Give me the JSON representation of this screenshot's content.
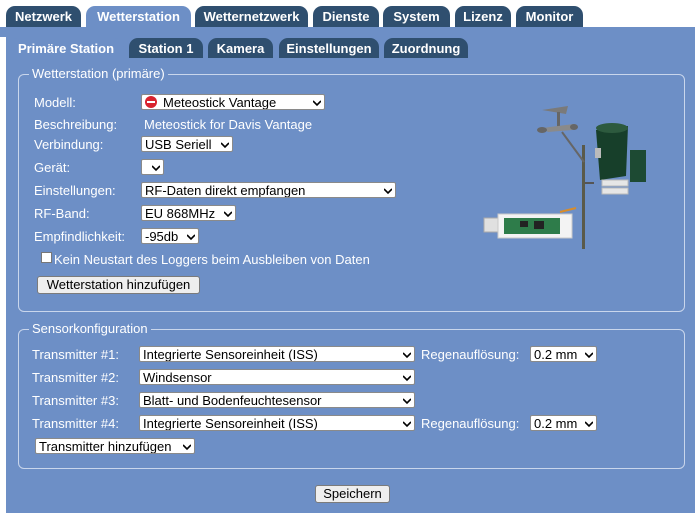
{
  "main_tabs": [
    {
      "label": "Netzwerk",
      "active": false
    },
    {
      "label": "Wetterstation",
      "active": true
    },
    {
      "label": "Wetternetzwerk",
      "active": false
    },
    {
      "label": "Dienste",
      "active": false
    },
    {
      "label": "System",
      "active": false
    },
    {
      "label": "Lizenz",
      "active": false
    },
    {
      "label": "Monitor",
      "active": false
    }
  ],
  "sub_tabs": [
    {
      "label": "Primäre Station",
      "active": true
    },
    {
      "label": "Station 1",
      "active": false
    },
    {
      "label": "Kamera",
      "active": false
    },
    {
      "label": "Einstellungen",
      "active": false
    },
    {
      "label": "Zuordnung",
      "active": false
    }
  ],
  "station": {
    "legend": "Wetterstation (primäre)",
    "model_label": "Modell:",
    "model_value": "Meteostick Vantage",
    "description_label": "Beschreibung:",
    "description_value": "Meteostick for Davis Vantage",
    "connection_label": "Verbindung:",
    "connection_value": "USB Seriell",
    "device_label": "Gerät:",
    "device_value": "",
    "settings_label": "Einstellungen:",
    "settings_value": "RF-Daten direkt empfangen",
    "rfband_label": "RF-Band:",
    "rfband_value": "EU 868MHz",
    "sensitivity_label": "Empfindlichkeit:",
    "sensitivity_value": "-95db",
    "no_restart_label": "Kein Neustart des Loggers beim Ausbleiben von Daten",
    "no_restart_checked": false,
    "add_station_button": "Wetterstation hinzufügen"
  },
  "sensors": {
    "legend": "Sensorkonfiguration",
    "transmitters": [
      {
        "label": "Transmitter #1:",
        "value": "Integrierte Sensoreinheit (ISS)",
        "rain_label": "Regenauflösung:",
        "rain_value": "0.2 mm"
      },
      {
        "label": "Transmitter #2:",
        "value": "Windsensor"
      },
      {
        "label": "Transmitter #3:",
        "value": "Blatt- und Bodenfeuchtesensor"
      },
      {
        "label": "Transmitter #4:",
        "value": "Integrierte Sensoreinheit (ISS)",
        "rain_label": "Regenauflösung:",
        "rain_value": "0.2 mm"
      }
    ],
    "add_transmitter": "Transmitter hinzufügen"
  },
  "save_button": "Speichern",
  "colors": {
    "panel": "#6d8fc6",
    "tab_inactive": "#2f4f6f",
    "border": "#c9d6ec"
  }
}
